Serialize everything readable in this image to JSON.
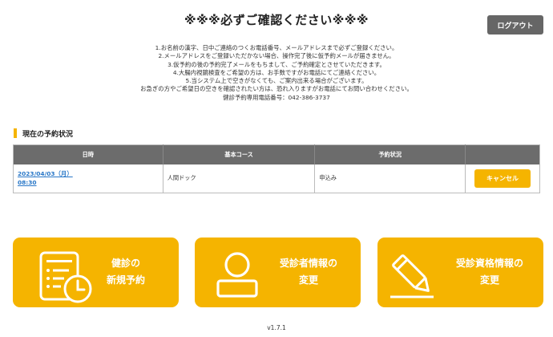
{
  "header": {
    "title": "※※※必ずご確認ください※※※",
    "logout_label": "ログアウト"
  },
  "notice": {
    "lines": [
      "1.お名前の漢字、日中ご連絡のつくお電話番号、メールアドレスまで必ずご登録ください。",
      "2.メールアドレスをご登録いただかない場合、操作完了後に仮予約メールが届きません。",
      "3.仮予約の後の予約完了メールをもちまして、ご予約確定とさせていただきます。",
      "4.大腸内視鏡検査をご希望の方は、お手数ですがお電話にてご連絡ください。",
      "5.当システム上で空きがなくても、ご案内出来る場合がございます。",
      "お急ぎの方やご希望日の空きを確認されたい方は、恐れ入りますがお電話にてお問い合わせください。",
      "健診予約専用電話番号：042-386-3737"
    ]
  },
  "reservations": {
    "section_title": "現在の予約状況",
    "columns": [
      "日時",
      "基本コース",
      "予約状況",
      ""
    ],
    "rows": [
      {
        "date_line1": "2023/04/03（月）",
        "date_line2": "08:30",
        "course": "人間ドック",
        "status": "申込み",
        "action_label": "キャンセル"
      }
    ]
  },
  "tiles": [
    {
      "line1": "健診の",
      "line2": "新規予約",
      "icon": "clipboard-clock-icon"
    },
    {
      "line1": "受診者情報の",
      "line2": "変更",
      "icon": "person-icon"
    },
    {
      "line1": "受診資格情報の",
      "line2": "変更",
      "icon": "pencil-icon"
    }
  ],
  "footer": {
    "version": "v1.7.1"
  },
  "colors": {
    "accent": "#f5b400",
    "header_bg": "#6c6c6c",
    "logout_bg": "#666666",
    "link": "#2a78c8"
  }
}
